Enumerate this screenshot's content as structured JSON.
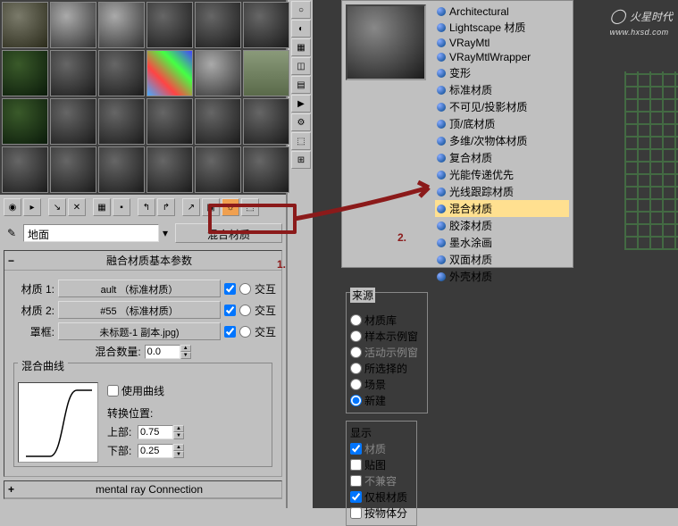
{
  "materialEditor": {
    "nameField": "地面",
    "typeBtn": "混合材质",
    "rollouts": {
      "blend": {
        "title": "融合材质基本参数",
        "mat1Label": "材质 1:",
        "mat1Slot": "ault （标准材质）",
        "mat2Label": "材质 2:",
        "mat2Slot": "#55 （标准材质）",
        "maskLabel": "罩框:",
        "maskSlot": "未标题-1 副本.jpg)",
        "interactive": "交互",
        "mixAmountLabel": "混合数量:",
        "mixAmount": "0.0",
        "curve": {
          "groupTitle": "混合曲线",
          "useCurve": "使用曲线",
          "transLabel": "转换位置:",
          "upperLabel": "上部:",
          "upper": "0.75",
          "lowerLabel": "下部:",
          "lower": "0.25"
        }
      },
      "mentalRay": {
        "title": "mental ray Connection"
      }
    }
  },
  "browser": {
    "sourceTitle": "来源",
    "sourceOptions": [
      "材质库",
      "样本示例窗",
      "活动示例窗",
      "所选择的",
      "场景",
      "新建"
    ],
    "displayTitle": "显示",
    "displayOptions": [
      "材质",
      "贴图",
      "不兼容",
      "仅根材质",
      "按物体分"
    ],
    "materials": [
      "Architectural",
      "Lightscape 材质",
      "VRayMtl",
      "VRayMtlWrapper",
      "变形",
      "标准材质",
      "不可见/投影材质",
      "顶/底材质",
      "多维/次物体材质",
      "复合材质",
      "光能传递优先",
      "光线跟踪材质",
      "混合材质",
      "胶漆材质",
      "墨水涂画",
      "双面材质",
      "外壳材质"
    ],
    "selectedIndex": 12
  },
  "watermark": {
    "brand": "火星时代",
    "url": "www.hxsd.com"
  },
  "annotations": {
    "num1": "1.",
    "num2": "2."
  }
}
